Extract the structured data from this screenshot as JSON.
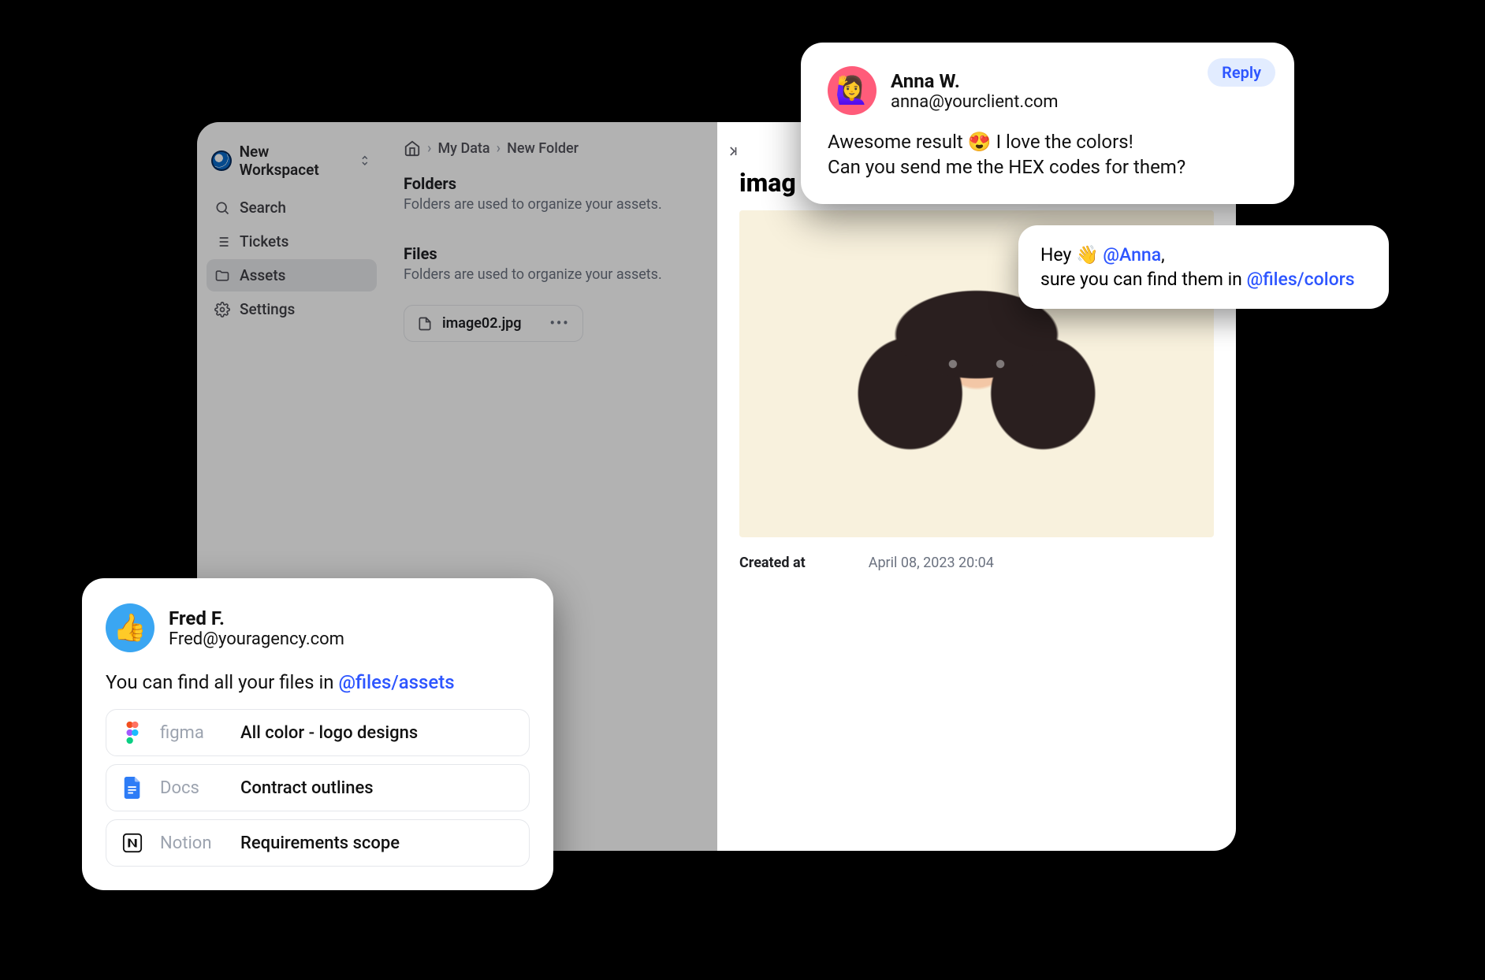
{
  "sidebar": {
    "workspace_name": "New Workspacet",
    "items": [
      {
        "label": "Search"
      },
      {
        "label": "Tickets"
      },
      {
        "label": "Assets"
      },
      {
        "label": "Settings"
      }
    ]
  },
  "breadcrumbs": {
    "root": "My Data",
    "current": "New Folder"
  },
  "sections": {
    "folders": {
      "title": "Folders",
      "subtitle": "Folders are used to organize your assets."
    },
    "files": {
      "title": "Files",
      "subtitle": "Folders are used to organize your assets.",
      "items": [
        {
          "name": "image02.jpg"
        }
      ]
    }
  },
  "detail": {
    "title_visible": "imag",
    "meta": {
      "label": "Created at",
      "value": "April 08, 2023 20:04"
    }
  },
  "anna": {
    "reply_label": "Reply",
    "name": "Anna W.",
    "email": "anna@yourclient.com",
    "line1_a": "Awesome result ",
    "line1_b": " I love the colors!",
    "line2": "Can you send me the HEX codes for them?"
  },
  "subreply": {
    "pre": "Hey ",
    "mention1": "@Anna",
    "comma": ",",
    "line2_a": "sure you can find them in ",
    "mention2": "@files/colors"
  },
  "fred": {
    "name": "Fred F.",
    "email": "Fred@youragency.com",
    "body_a": "You can find all your files in ",
    "body_mention": "@files/assets",
    "attachments": [
      {
        "service": "figma",
        "title": "All color - logo designs"
      },
      {
        "service": "Docs",
        "title": "Contract outlines"
      },
      {
        "service": "Notion",
        "title": "Requirements scope"
      }
    ]
  }
}
